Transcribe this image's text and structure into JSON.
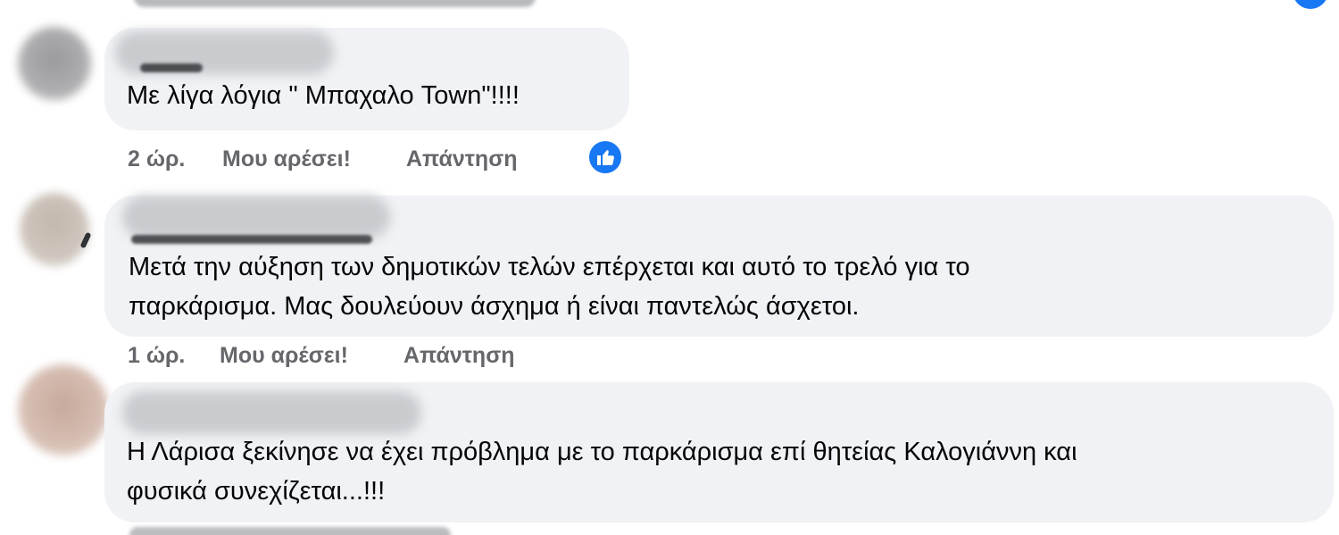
{
  "comments": [
    {
      "text_lines": [
        "Με λίγα λόγια \" Μπαχαλο Town\"!!!!"
      ],
      "time": "2 ώρ.",
      "like_label": "Μου αρέσει!",
      "reply_label": "Απάντηση",
      "reaction_icon": "thumbs-up-icon"
    },
    {
      "text_lines": [
        "Μετά την αύξηση των δημοτικών τελών επέρχεται και αυτό το τρελό για το",
        "παρκάρισμα. Μας δουλεύουν άσχημα ή είναι παντελώς άσχετοι."
      ],
      "time": "1 ώρ.",
      "like_label": "Μου αρέσει!",
      "reply_label": "Απάντηση"
    },
    {
      "text_lines": [
        "Η Λάρισα ξεκίνησε να έχει πρόβλημα με το παρκάρισμα επί θητείας Καλογιάννη και",
        "φυσικά συνεχίζεται...!!!"
      ]
    }
  ],
  "colors": {
    "bubble_bg": "#f0f2f5",
    "meta_text": "#65676b",
    "like_blue": "#1877f2"
  }
}
